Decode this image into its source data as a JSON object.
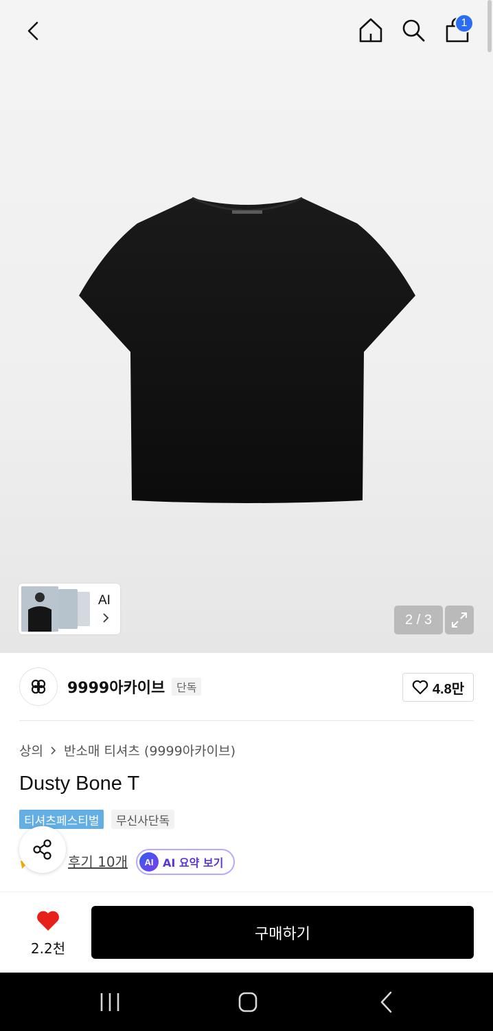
{
  "header": {
    "icons": [
      "back-icon",
      "home-icon",
      "search-icon",
      "cart-icon"
    ],
    "cart_badge": "1"
  },
  "gallery": {
    "ai_label": "AI",
    "page_counter": "2 / 3"
  },
  "brand": {
    "name": "9999아카이브",
    "tag": "단독",
    "like_count": "4.8만"
  },
  "product": {
    "breadcrumb": [
      "상의",
      "반소매 티셔츠 (9999아카이브)"
    ],
    "title": "Dusty Bone T",
    "tags": [
      "티셔츠페스티벌",
      "무신사단독"
    ],
    "review_link": "후기 10개",
    "ai_summary": {
      "badge": "AI",
      "label": "AI 요약 보기"
    }
  },
  "action_bar": {
    "wish_count": "2.2천",
    "buy_label": "구매하기"
  },
  "colors": {
    "accent_blue": "#2a6df4",
    "festival_tag": "#63aee3",
    "heart_red": "#e8201c",
    "ai_purple": "#5a36d6",
    "buy_button": "#000000"
  }
}
